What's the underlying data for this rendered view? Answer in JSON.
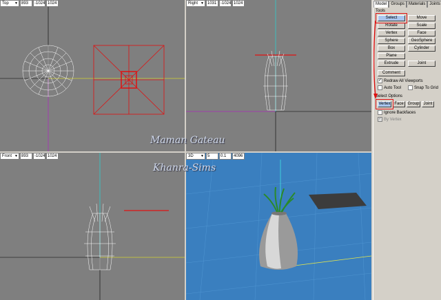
{
  "viewports": {
    "top": {
      "view": "Top",
      "fields": [
        "893",
        "-1024",
        "1024"
      ]
    },
    "right": {
      "view": "Right",
      "fields": [
        "1031",
        "-1024",
        "1024"
      ]
    },
    "front": {
      "view": "Front",
      "fields": [
        "893",
        "-1024",
        "1024"
      ]
    },
    "persp": {
      "view": "3D",
      "fields": [
        "5",
        "0.1",
        "4096"
      ]
    }
  },
  "panel": {
    "tabs": [
      "Model",
      "Groups",
      "Materials",
      "Joints"
    ],
    "tools_label": "Tools",
    "tool_buttons": [
      "Select",
      "Move",
      "Rotate",
      "Scale",
      "Vertex",
      "Face",
      "Sphere",
      "GeoSphere",
      "Box",
      "Cylinder",
      "Plane",
      "Extrude",
      "Joint"
    ],
    "comment_label": "Comment",
    "redraw_label": "Redraw All Viewports",
    "autotool_label": "Auto Tool",
    "snap_label": "Snap To Grid",
    "select_options_label": "Select Options",
    "select_buttons": [
      "Vertex",
      "Face",
      "Group",
      "Joint"
    ],
    "ignore_backfaces_label": "Ignore Backfaces",
    "by_vertex_label": "By Vertex"
  },
  "watermark": {
    "line1": "Maman Gateau",
    "line2": "Khanra-Sims"
  },
  "colors": {
    "viewport_bg": "#7f7f7f",
    "persp_bg": "#3a7fbf",
    "highlight": "#e01010",
    "select_button": "#a9c6ef"
  }
}
